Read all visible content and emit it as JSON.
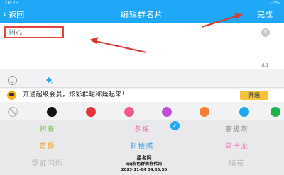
{
  "status_bar": {
    "time": "20:29",
    "right": "72%"
  },
  "nav": {
    "back_label": "返回",
    "title": "编辑群名片",
    "done_label": "完成"
  },
  "name_field": {
    "value": "阿心",
    "counter": "44"
  },
  "vip_bar": {
    "text": "开通超级会员，炫彩群昵称燥起来！",
    "button_label": "开通"
  },
  "swatches": [
    {
      "name": "none",
      "color": "none"
    },
    {
      "name": "black",
      "color": "#111111"
    },
    {
      "name": "red",
      "color": "#e8333a"
    },
    {
      "name": "pink",
      "color": "#f05b8b"
    },
    {
      "name": "purple",
      "color": "#c34ed6"
    },
    {
      "name": "orange",
      "color": "#f47f33"
    },
    {
      "name": "blue",
      "color": "#1ba9f3"
    },
    {
      "name": "green",
      "color": "#1bb34a"
    },
    {
      "name": "yellow",
      "color": "#f4b400"
    }
  ],
  "name_cards": [
    {
      "label": "初春",
      "color": "#8dc768",
      "selected": false
    },
    {
      "label": "冬梅",
      "color": "#e86fa1",
      "selected": true
    },
    {
      "label": "高级灰",
      "color": "#8d8d8d",
      "selected": false
    },
    {
      "label": "黄昏",
      "color": "#e6a93a",
      "selected": false
    },
    {
      "label": "科技感",
      "color": "#3aa0e6",
      "selected": false
    },
    {
      "label": "马卡龙",
      "color": "#e77fb8",
      "selected": false
    },
    {
      "label": "霓虹闪烁",
      "color": "#b9b9b9",
      "selected": false
    },
    {
      "label": "",
      "color": "#b9b9b9",
      "selected": false
    },
    {
      "label": "暗夜",
      "color": "#b9b9b9",
      "selected": false
    }
  ],
  "watermark": {
    "line1": "星名网",
    "line2": "qq彩色群昵称代码",
    "line3": "2023-11-04 04:55:58"
  }
}
